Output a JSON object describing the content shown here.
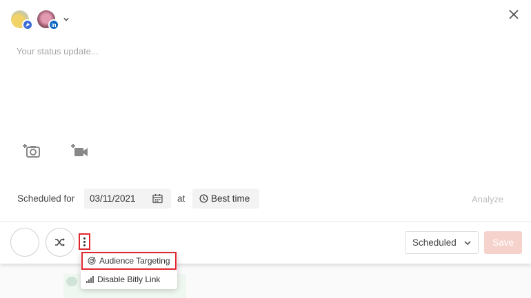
{
  "composer": {
    "placeholder": "Your status update...",
    "accounts": [
      {
        "badge_icon": "pin-badge-icon",
        "badge_color": "#3b6bd6"
      },
      {
        "badge_text": "in",
        "badge_color": "#0a66c2"
      }
    ]
  },
  "schedule": {
    "label": "Scheduled for",
    "date": "03/11/2021",
    "at_label": "at",
    "best_time_label": "Best time",
    "analyze_label": "Analyze"
  },
  "footer": {
    "status_value": "Scheduled",
    "save_label": "Save"
  },
  "menu": {
    "items": [
      {
        "label": "Audience Targeting",
        "icon": "target-icon"
      },
      {
        "label": "Disable Bitly Link",
        "icon": "signal-bars-icon"
      }
    ]
  },
  "colors": {
    "highlight": "#e0262e",
    "save_disabled": "#f6d2cc",
    "linkedin": "#0a66c2"
  }
}
